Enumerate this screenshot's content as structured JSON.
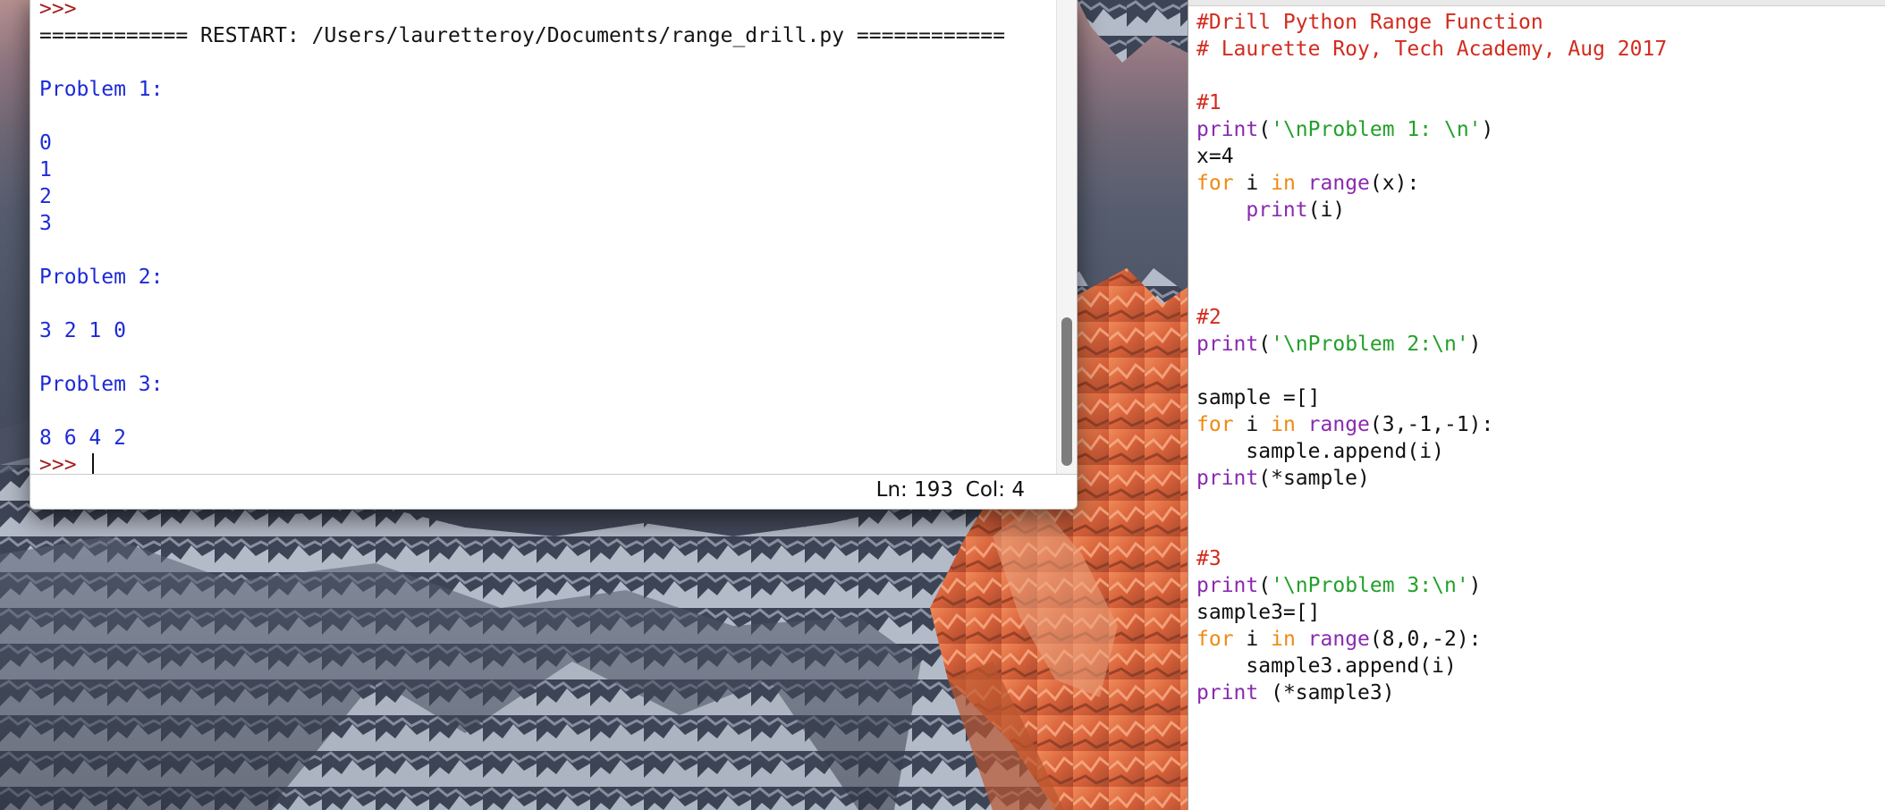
{
  "colors": {
    "prompt": "#a51d1d",
    "output": "#1d2ad8",
    "comment": "#d22b1e",
    "builtin": "#8a2ab0",
    "string": "#22a02a",
    "keyword": "#ee8a12",
    "default": "#111111"
  },
  "shell": {
    "lines": [
      {
        "type": "prompt",
        "text": ">>>"
      },
      {
        "type": "restart",
        "text": "============ RESTART: /Users/lauretteroy/Documents/range_drill.py ============"
      },
      {
        "type": "blank",
        "text": ""
      },
      {
        "type": "output",
        "text": "Problem 1:"
      },
      {
        "type": "blank",
        "text": ""
      },
      {
        "type": "output",
        "text": "0"
      },
      {
        "type": "output",
        "text": "1"
      },
      {
        "type": "output",
        "text": "2"
      },
      {
        "type": "output",
        "text": "3"
      },
      {
        "type": "blank",
        "text": ""
      },
      {
        "type": "output",
        "text": "Problem 2:"
      },
      {
        "type": "blank",
        "text": ""
      },
      {
        "type": "output",
        "text": "3 2 1 0"
      },
      {
        "type": "blank",
        "text": ""
      },
      {
        "type": "output",
        "text": "Problem 3:"
      },
      {
        "type": "blank",
        "text": ""
      },
      {
        "type": "output",
        "text": "8 6 4 2"
      },
      {
        "type": "current-prompt",
        "text": ">>> "
      }
    ],
    "status": {
      "ln": "Ln: 193",
      "col": "Col: 4"
    }
  },
  "editor": {
    "lines": [
      [
        {
          "k": "comment",
          "t": "#Drill Python Range Function"
        }
      ],
      [
        {
          "k": "comment",
          "t": "# Laurette Roy, Tech Academy, Aug 2017"
        }
      ],
      [],
      [
        {
          "k": "comment",
          "t": "#1"
        }
      ],
      [
        {
          "k": "builtin",
          "t": "print"
        },
        {
          "k": "default",
          "t": "("
        },
        {
          "k": "string",
          "t": "'\\nProblem 1: \\n'"
        },
        {
          "k": "default",
          "t": ")"
        }
      ],
      [
        {
          "k": "default",
          "t": "x=4"
        }
      ],
      [
        {
          "k": "keyword",
          "t": "for"
        },
        {
          "k": "default",
          "t": " i "
        },
        {
          "k": "keyword",
          "t": "in"
        },
        {
          "k": "default",
          "t": " "
        },
        {
          "k": "builtin",
          "t": "range"
        },
        {
          "k": "default",
          "t": "(x):"
        }
      ],
      [
        {
          "k": "default",
          "t": "    "
        },
        {
          "k": "builtin",
          "t": "print"
        },
        {
          "k": "default",
          "t": "(i)"
        }
      ],
      [],
      [],
      [],
      [
        {
          "k": "comment",
          "t": "#2"
        }
      ],
      [
        {
          "k": "builtin",
          "t": "print"
        },
        {
          "k": "default",
          "t": "("
        },
        {
          "k": "string",
          "t": "'\\nProblem 2:\\n'"
        },
        {
          "k": "default",
          "t": ")"
        }
      ],
      [],
      [
        {
          "k": "default",
          "t": "sample =[]"
        }
      ],
      [
        {
          "k": "keyword",
          "t": "for"
        },
        {
          "k": "default",
          "t": " i "
        },
        {
          "k": "keyword",
          "t": "in"
        },
        {
          "k": "default",
          "t": " "
        },
        {
          "k": "builtin",
          "t": "range"
        },
        {
          "k": "default",
          "t": "(3,-1,-1):"
        }
      ],
      [
        {
          "k": "default",
          "t": "    sample.append(i)"
        }
      ],
      [
        {
          "k": "builtin",
          "t": "print"
        },
        {
          "k": "default",
          "t": "(*sample)"
        }
      ],
      [],
      [],
      [
        {
          "k": "comment",
          "t": "#3"
        }
      ],
      [
        {
          "k": "builtin",
          "t": "print"
        },
        {
          "k": "default",
          "t": "("
        },
        {
          "k": "string",
          "t": "'\\nProblem 3:\\n'"
        },
        {
          "k": "default",
          "t": ")"
        }
      ],
      [
        {
          "k": "default",
          "t": "sample3=[]"
        }
      ],
      [
        {
          "k": "keyword",
          "t": "for"
        },
        {
          "k": "default",
          "t": " i "
        },
        {
          "k": "keyword",
          "t": "in"
        },
        {
          "k": "default",
          "t": " "
        },
        {
          "k": "builtin",
          "t": "range"
        },
        {
          "k": "default",
          "t": "(8,0,-2):"
        }
      ],
      [
        {
          "k": "default",
          "t": "    sample3.append(i)"
        }
      ],
      [
        {
          "k": "builtin",
          "t": "print"
        },
        {
          "k": "default",
          "t": " (*sample3)"
        }
      ]
    ]
  }
}
